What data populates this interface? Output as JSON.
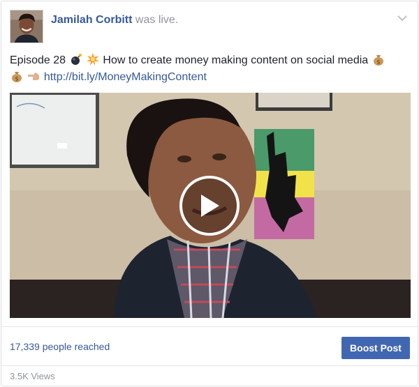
{
  "post": {
    "author": "Jamilah Corbitt",
    "status": "was live.",
    "text_episode": "Episode 28",
    "text_title": "How to create money making content on social media",
    "link": "http://bit.ly/MoneyMakingContent"
  },
  "footer": {
    "reach": "17,339 people reached",
    "boost_label": "Boost Post",
    "views": "3.5K Views"
  },
  "icons": [
    "avatar",
    "chevron-down-icon",
    "bomb-icon",
    "collision-icon",
    "money-bag-icon",
    "pointing-left-icon",
    "play-icon"
  ],
  "colors": {
    "link": "#365899",
    "boost_button": "#4267b2",
    "muted": "#90949c",
    "text": "#1d2129"
  }
}
